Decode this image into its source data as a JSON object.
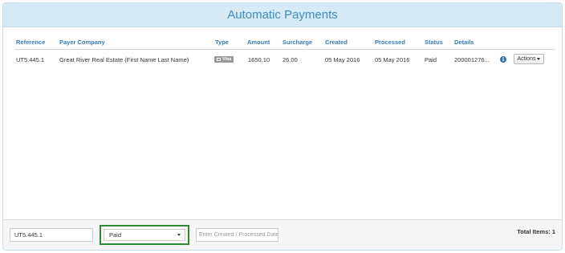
{
  "panel": {
    "title": "Automatic Payments"
  },
  "table": {
    "columns": [
      "Reference",
      "Payer Company",
      "Type",
      "Amount",
      "Surcharge",
      "Created",
      "Processed",
      "Status",
      "Details"
    ],
    "rows": [
      {
        "reference": "UT5.445.1",
        "payer_company": "Great River Real Estate (First Name Last Name)",
        "type": "Visa",
        "amount": "1650.10",
        "surcharge": "26.00",
        "created": "05 May 2016",
        "processed": "05 May 2016",
        "status": "Paid",
        "details": "200001276...",
        "info_icon": "info-icon",
        "actions_label": "Actions"
      }
    ]
  },
  "footer": {
    "reference_filter_value": "UT5.445.1",
    "status_filter_value": "Paid",
    "date_filter_placeholder": "Enter Created / Processed Date",
    "total_items_label": "Total Items: 1"
  },
  "colors": {
    "header_bg": "#d6eaf5",
    "title": "#3f8ec2",
    "column_header": "#3a79b0",
    "focus_border": "#2b8a32"
  }
}
